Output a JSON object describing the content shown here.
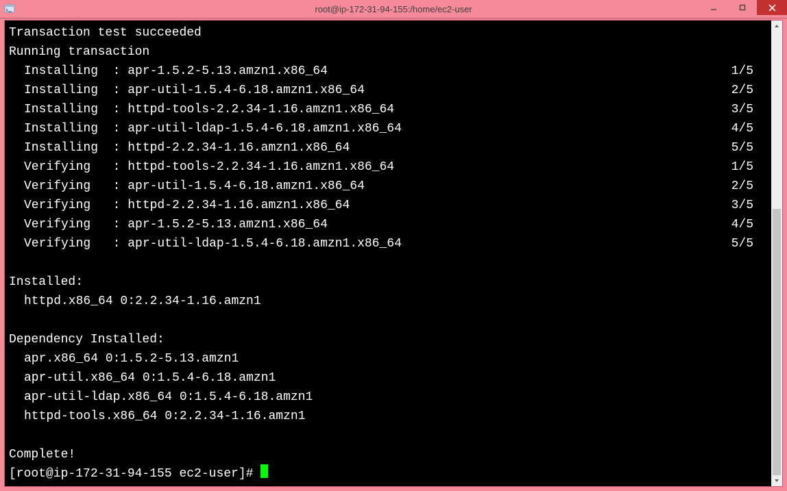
{
  "window": {
    "title": "root@ip-172-31-94-155:/home/ec2-user",
    "icon": "terminal-icon",
    "colors": {
      "titlebar": "#f58a9b",
      "close": "#c43131",
      "term_bg": "#000000",
      "term_fg": "#ffffff",
      "accent": "#00ff00"
    }
  },
  "terminal": {
    "pre_lines": [
      "Transaction test succeeded",
      "Running transaction"
    ],
    "steps": [
      {
        "action": "Installing",
        "pkg": "apr-1.5.2-5.13.amzn1.x86_64",
        "count": "1/5"
      },
      {
        "action": "Installing",
        "pkg": "apr-util-1.5.4-6.18.amzn1.x86_64",
        "count": "2/5"
      },
      {
        "action": "Installing",
        "pkg": "httpd-tools-2.2.34-1.16.amzn1.x86_64",
        "count": "3/5"
      },
      {
        "action": "Installing",
        "pkg": "apr-util-ldap-1.5.4-6.18.amzn1.x86_64",
        "count": "4/5"
      },
      {
        "action": "Installing",
        "pkg": "httpd-2.2.34-1.16.amzn1.x86_64",
        "count": "5/5"
      },
      {
        "action": "Verifying",
        "pkg": "httpd-tools-2.2.34-1.16.amzn1.x86_64",
        "count": "1/5"
      },
      {
        "action": "Verifying",
        "pkg": "apr-util-1.5.4-6.18.amzn1.x86_64",
        "count": "2/5"
      },
      {
        "action": "Verifying",
        "pkg": "httpd-2.2.34-1.16.amzn1.x86_64",
        "count": "3/5"
      },
      {
        "action": "Verifying",
        "pkg": "apr-1.5.2-5.13.amzn1.x86_64",
        "count": "4/5"
      },
      {
        "action": "Verifying",
        "pkg": "apr-util-ldap-1.5.4-6.18.amzn1.x86_64",
        "count": "5/5"
      }
    ],
    "installed_header": "Installed:",
    "installed": [
      "httpd.x86_64 0:2.2.34-1.16.amzn1"
    ],
    "dep_header": "Dependency Installed:",
    "deps": [
      "apr.x86_64 0:1.5.2-5.13.amzn1",
      "apr-util.x86_64 0:1.5.4-6.18.amzn1",
      "apr-util-ldap.x86_64 0:1.5.4-6.18.amzn1",
      "httpd-tools.x86_64 0:2.2.34-1.16.amzn1"
    ],
    "complete": "Complete!",
    "prompt": "[root@ip-172-31-94-155 ec2-user]# "
  }
}
